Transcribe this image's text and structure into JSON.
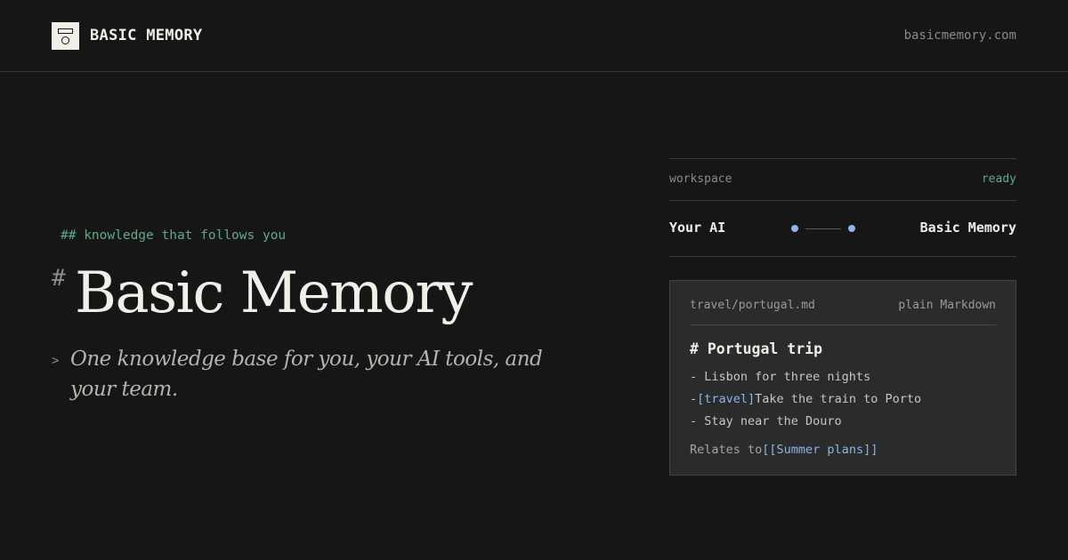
{
  "header": {
    "brand": "BASIC MEMORY",
    "site_url": "basicmemory.com",
    "logo_icon": "basic-memory-logo-icon"
  },
  "hero": {
    "kicker": "## knowledge that follows you",
    "hash_mark": "#",
    "title": "Basic Memory",
    "quote_mark": ">",
    "tagline": "One knowledge base for you, your AI tools, and your team."
  },
  "panel": {
    "status": {
      "label": "workspace",
      "value": "ready"
    },
    "connection": {
      "left": "Your AI",
      "right": "Basic Memory"
    },
    "note": {
      "path": "travel/portugal.md",
      "format": "plain Markdown",
      "heading": "# Portugal trip",
      "item1": "- Lisbon for three nights",
      "item2_prefix": "-",
      "item2_tag": "[travel]",
      "item2_text": "Take the train to Porto",
      "item3": "- Stay near the Douro",
      "relates_prefix": "Relates to",
      "relates_link": "[[Summer plans]]"
    }
  },
  "colors": {
    "background": "#161616",
    "card": "#2b2b2b",
    "accent_green": "#5faa86",
    "accent_blue": "#8fb3e8",
    "text_primary": "#f1efe8",
    "text_muted": "#8c8a85"
  }
}
